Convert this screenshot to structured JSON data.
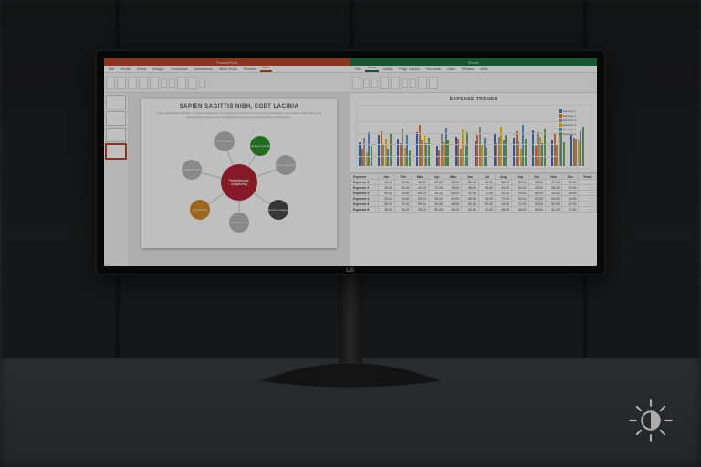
{
  "monitor": {
    "brand": "LG"
  },
  "brightness_icon": "brightness-icon",
  "ppt": {
    "titlebar": "PowerPoint",
    "tabs": [
      "File",
      "Home",
      "Insert",
      "Design",
      "Transitions",
      "Animations",
      "Slide Show",
      "Review",
      "View"
    ],
    "active_tab_index": 8,
    "slide": {
      "title": "SAPIEN SAGITTIS NIBH, EGET LACINIA",
      "subtitle": "Lorem ipsum dolor sit amet, consectetur adipiscing elit. Pellentesque mattis orci non feugiat pellentesque, arcu sapien sagittis nibh, eget lacinia turpis massa nec leo. Suspendisse sed purus consectetur lectus. Suspendisse.",
      "hub": {
        "label": "Pellentesque Adipiscing",
        "color": "#b22234"
      },
      "nodes": [
        {
          "label": "Quisque gravida",
          "color": "#2f8f2f",
          "angle": -60,
          "r": 46
        },
        {
          "label": "Lorem placerat",
          "color": "#b7b7b7",
          "angle": -20,
          "r": 54
        },
        {
          "label": "Aenean congue",
          "color": "#4a4a4a",
          "angle": 35,
          "r": 52
        },
        {
          "label": "Nullam mauris",
          "color": "#b7b7b7",
          "angle": 90,
          "r": 44
        },
        {
          "label": "Lorem luctus",
          "color": "#d08a2a",
          "angle": 145,
          "r": 52
        },
        {
          "label": "Nullam mauris",
          "color": "#b7b7b7",
          "angle": 195,
          "r": 54
        },
        {
          "label": "Lorem efficitur",
          "color": "#b7b7b7",
          "angle": -110,
          "r": 48
        }
      ]
    }
  },
  "xls": {
    "titlebar": "Excel",
    "tabs": [
      "File",
      "Home",
      "Insert",
      "Page Layout",
      "Formulas",
      "Data",
      "Review",
      "View"
    ],
    "active_tab_index": 1,
    "chart_title": "EXPENSE TRENDS",
    "legend": [
      "Expense 1",
      "Expense 2",
      "Expense 3",
      "Expense 4",
      "Expense 5",
      "Expense 6"
    ],
    "colors": [
      "#4472c4",
      "#ed7d31",
      "#a5a5a5",
      "#ffc000",
      "#5b9bd5",
      "#70ad47"
    ],
    "months": [
      "Jan",
      "Feb",
      "Mar",
      "Apr",
      "May",
      "Jun",
      "Jul",
      "Aug",
      "Sep",
      "Oct",
      "Nov",
      "Dec"
    ],
    "table_rows": [
      "Expense 1",
      "Expense 2",
      "Expense 3",
      "Expense 4",
      "Expense 5",
      "Expense 6"
    ]
  },
  "chart_data": {
    "type": "bar",
    "title": "EXPENSE TRENDS",
    "xlabel": "",
    "ylabel": "",
    "ylim": [
      0,
      100
    ],
    "categories": [
      "Jan",
      "Feb",
      "Mar",
      "Apr",
      "May",
      "Jun",
      "Jul",
      "Aug",
      "Sep",
      "Oct",
      "Nov",
      "Dec"
    ],
    "series": [
      {
        "name": "Expense 1",
        "color": "#4472c4",
        "values": [
          42,
          55,
          48,
          60,
          35,
          52,
          44,
          58,
          50,
          63,
          47,
          55
        ]
      },
      {
        "name": "Expense 2",
        "color": "#ed7d31",
        "values": [
          30,
          62,
          40,
          72,
          28,
          48,
          55,
          40,
          62,
          35,
          58,
          50
        ]
      },
      {
        "name": "Expense 3",
        "color": "#a5a5a5",
        "values": [
          50,
          38,
          66,
          45,
          58,
          30,
          70,
          52,
          44,
          60,
          38,
          48
        ]
      },
      {
        "name": "Expense 4",
        "color": "#ffc000",
        "values": [
          25,
          48,
          33,
          55,
          42,
          65,
          38,
          70,
          30,
          52,
          60,
          46
        ]
      },
      {
        "name": "Expense 5",
        "color": "#5b9bd5",
        "values": [
          60,
          30,
          55,
          40,
          68,
          35,
          50,
          45,
          72,
          40,
          55,
          62
        ]
      },
      {
        "name": "Expense 6",
        "color": "#70ad47",
        "values": [
          35,
          58,
          28,
          50,
          46,
          60,
          32,
          55,
          48,
          66,
          42,
          70
        ]
      }
    ]
  }
}
